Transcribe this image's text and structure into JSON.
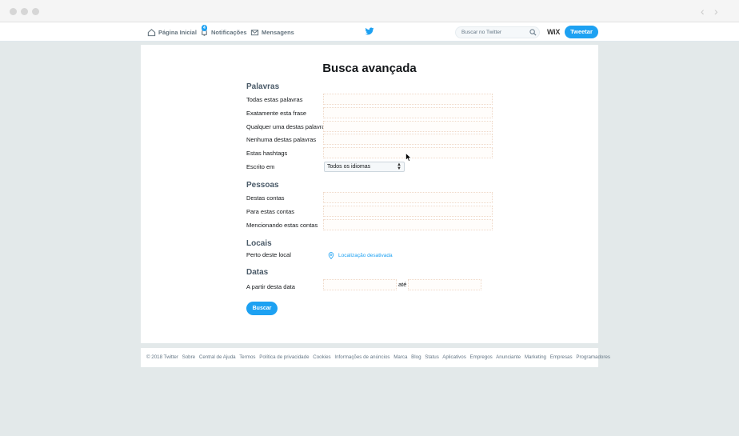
{
  "nav": {
    "home": "Página Inicial",
    "notifications": "Notificações",
    "notifications_badge": "4",
    "messages": "Mensagens",
    "search_placeholder": "Buscar no Twitter",
    "wix_label": "WiX",
    "tweet_button": "Tweetar"
  },
  "form": {
    "title": "Busca avançada",
    "sections": {
      "words": "Palavras",
      "people": "Pessoas",
      "places": "Locais",
      "dates": "Datas"
    },
    "labels": {
      "all_words": "Todas estas palavras",
      "exact_phrase": "Exatamente esta frase",
      "any_words": "Qualquer uma destas palavras",
      "none_words": "Nenhuma destas palavras",
      "hashtags": "Estas hashtags",
      "written_in": "Escrito em",
      "from_accounts": "Destas contas",
      "to_accounts": "Para estas contas",
      "mentioning": "Mencionando estas contas",
      "near_place": "Perto deste local",
      "from_date": "A partir desta data",
      "until": "até"
    },
    "language_value": "Todos os idiomas",
    "location_link": "Localização desativada",
    "search_button": "Buscar"
  },
  "footer": {
    "links": [
      "© 2018 Twitter",
      "Sobre",
      "Central de Ajuda",
      "Termos",
      "Política de privacidade",
      "Cookies",
      "Informações de anúncios",
      "Marca",
      "Blog",
      "Status",
      "Aplicativos",
      "Empregos",
      "Anunciante",
      "Marketing",
      "Empresas",
      "Programadores"
    ]
  },
  "colors": {
    "accent": "#1da1f2",
    "page_background": "#e3e9ea"
  }
}
